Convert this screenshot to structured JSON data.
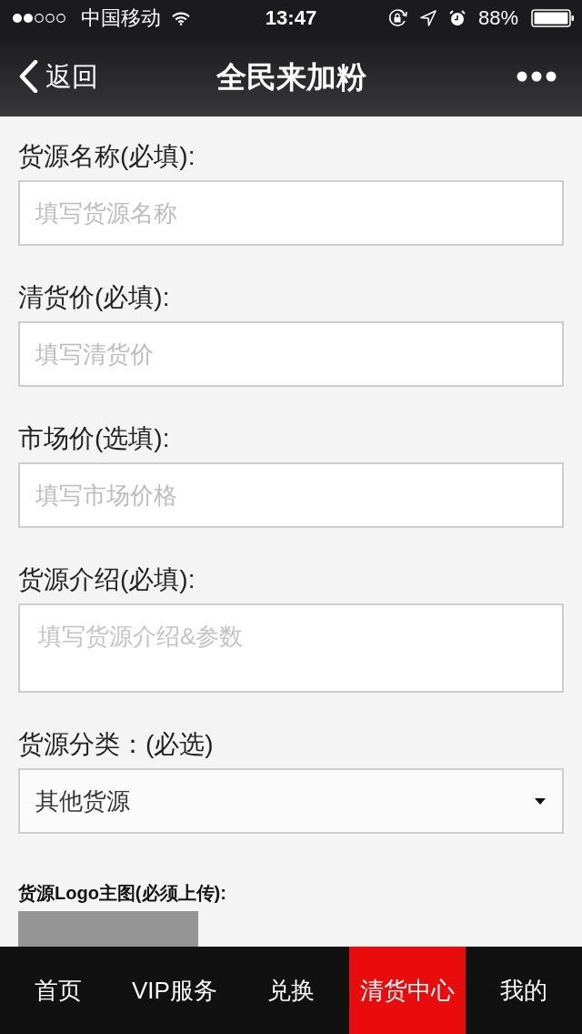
{
  "status_bar": {
    "carrier": "中国移动",
    "time": "13:47",
    "battery": "88%"
  },
  "nav_bar": {
    "back": "返回",
    "title": "全民来加粉"
  },
  "form": {
    "fields": [
      {
        "kind": "input",
        "label": "货源名称(必填):",
        "placeholder": "填写货源名称"
      },
      {
        "kind": "input",
        "label": "清货价(必填):",
        "placeholder": "填写清货价"
      },
      {
        "kind": "input",
        "label": "市场价(选填):",
        "placeholder": "填写市场价格"
      },
      {
        "kind": "textarea",
        "label": "货源介绍(必填):",
        "placeholder": "填写货源介绍&参数"
      },
      {
        "kind": "select",
        "label": "货源分类：(必选)",
        "value": "其他货源"
      }
    ],
    "upload": {
      "label": "货源Logo主图(必须上传):"
    }
  },
  "tabs": [
    {
      "label": "首页",
      "selected": false
    },
    {
      "label": "VIP服务",
      "selected": false
    },
    {
      "label": "兑换",
      "selected": false
    },
    {
      "label": "清货中心",
      "selected": true
    },
    {
      "label": "我的",
      "selected": false
    }
  ]
}
